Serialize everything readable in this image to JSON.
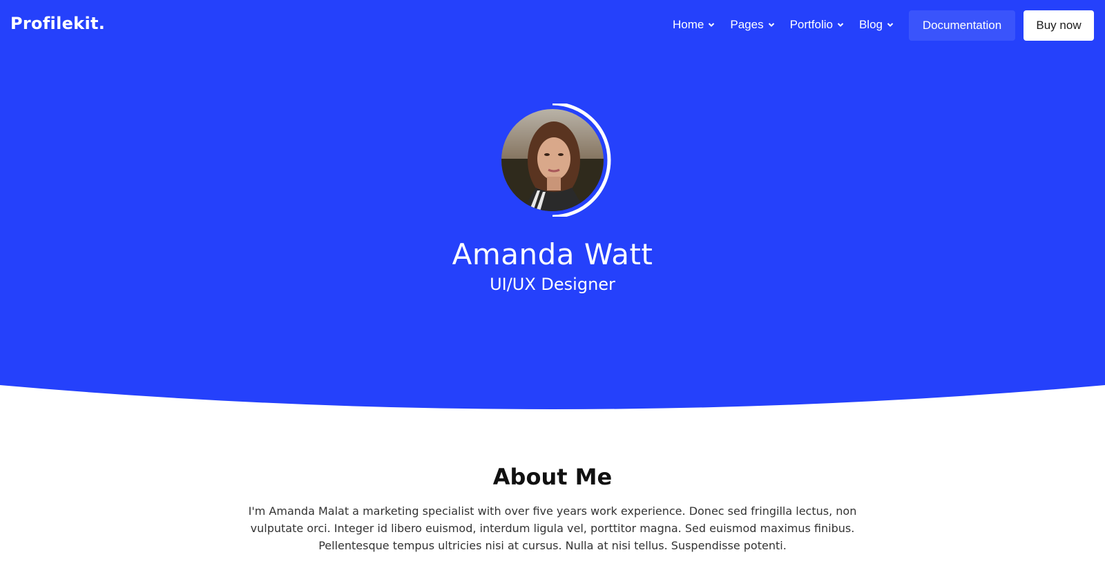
{
  "brand": {
    "logo": "Profilekit."
  },
  "nav": {
    "items": [
      {
        "label": "Home",
        "icon": "chevron-down-icon"
      },
      {
        "label": "Pages",
        "icon": "chevron-down-icon"
      },
      {
        "label": "Portfolio",
        "icon": "chevron-down-icon"
      },
      {
        "label": "Blog",
        "icon": "chevron-down-icon"
      }
    ],
    "documentation_label": "Documentation",
    "buy_label": "Buy now"
  },
  "profile": {
    "name": "Amanda Watt",
    "role": "UI/UX Designer",
    "avatar_icon": "profile-photo"
  },
  "about": {
    "title": "About Me",
    "text": "I'm Amanda Malat a marketing specialist with over five years work experience. Donec sed fringilla lectus, non vulputate orci. Integer id libero euismod, interdum ligula vel, porttitor magna. Sed euismod maximus finibus. Pellentesque tempus ultricies nisi at cursus. Nulla at nisi tellus. Suspendisse potenti."
  },
  "colors": {
    "hero_bg": "#2541fb",
    "doc_button_bg": "#3a54fb",
    "white": "#ffffff",
    "text_dark": "#111111"
  }
}
